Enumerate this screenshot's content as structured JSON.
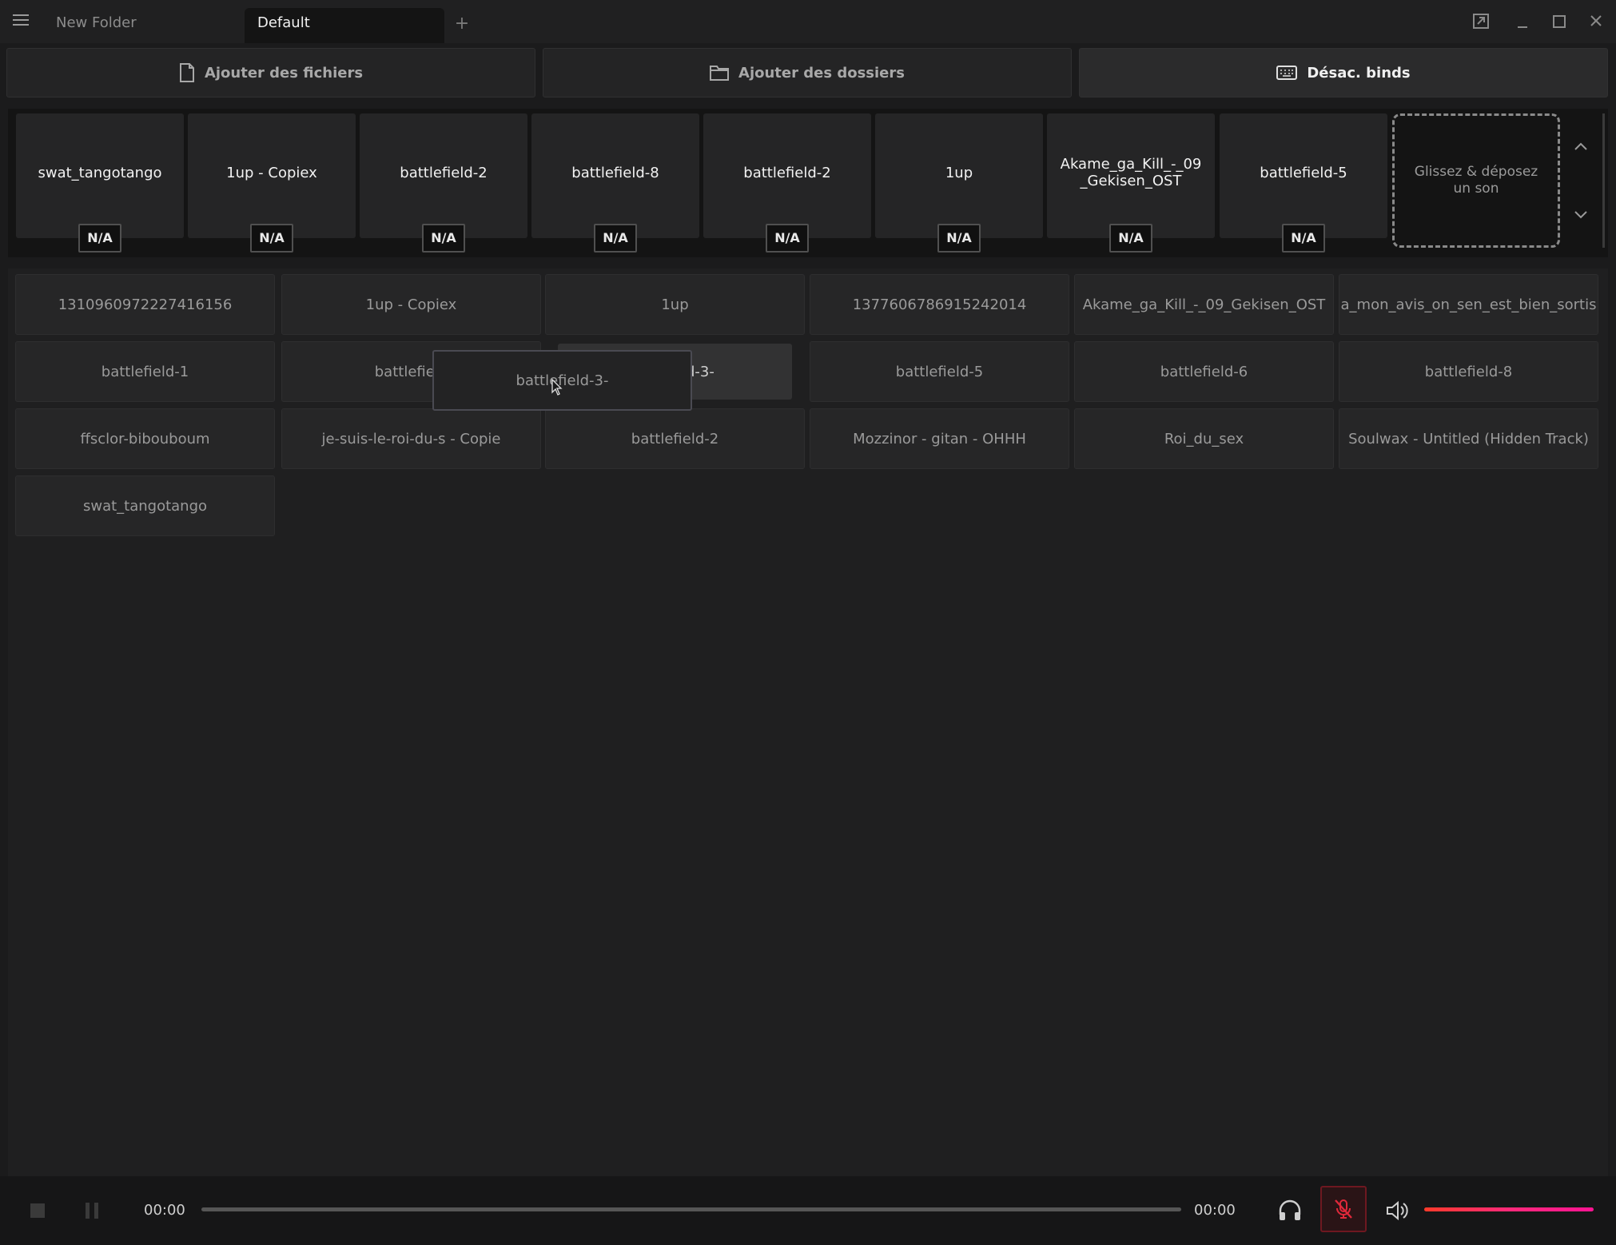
{
  "titlebar": {
    "tabs": [
      {
        "label": "New Folder",
        "active": false
      },
      {
        "label": "Default",
        "active": true
      }
    ],
    "add_tab_label": "+"
  },
  "toolbar": {
    "add_files_label": "Ajouter des fichiers",
    "add_folders_label": "Ajouter des dossiers",
    "disable_binds_label": "Désac. binds"
  },
  "slots": [
    {
      "name": "swat_tangotango",
      "bind": "N/A"
    },
    {
      "name": "1up - Copiex",
      "bind": "N/A"
    },
    {
      "name": "battlefield-2",
      "bind": "N/A"
    },
    {
      "name": "battlefield-8",
      "bind": "N/A"
    },
    {
      "name": "battlefield-2",
      "bind": "N/A"
    },
    {
      "name": "1up",
      "bind": "N/A"
    },
    {
      "name": "Akame_ga_Kill_-_09\n_Gekisen_OST",
      "bind": "N/A"
    },
    {
      "name": "battlefield-5",
      "bind": "N/A"
    }
  ],
  "drop_zone_label": "Glissez & déposez un son",
  "sounds": [
    "1310960972227416156",
    "1up - Copiex",
    "1up",
    "1377606786915242014",
    "Akame_ga_Kill_-_09_Gekisen_OST",
    "a_mon_avis_on_sen_est_bien_sortis",
    "battlefield-1",
    "battlefield",
    "",
    "battlefield-5",
    "battlefield-6",
    "battlefield-8",
    "ffsclor-bibouboum",
    "je-suis-le-roi-du-s - Copie",
    "battlefield-2",
    "Mozzinor - gitan - OHHH",
    "Roi_du_sex",
    "Soulwax - Untitled (Hidden Track)",
    "swat_tangotango"
  ],
  "drag": {
    "ghost_label": "battlefield-3-",
    "placeholder_label": "d-3-"
  },
  "player": {
    "current_time": "00:00",
    "total_time": "00:00",
    "progress": 0,
    "volume": 1.0,
    "mic_muted": true
  },
  "colors": {
    "accent_volume_start": "#ff3a2a",
    "accent_volume_end": "#ff1493",
    "mic_muted": "#e0283a"
  }
}
